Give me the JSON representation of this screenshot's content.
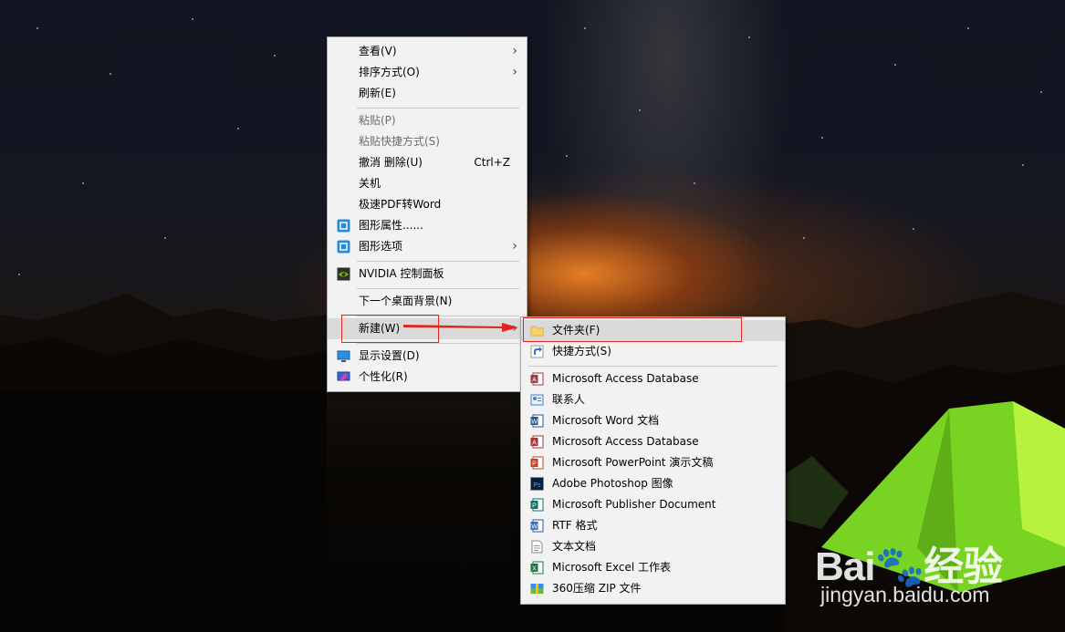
{
  "main_menu": {
    "items": [
      {
        "label": "查看(V)",
        "has_submenu": true
      },
      {
        "label": "排序方式(O)",
        "has_submenu": true
      },
      {
        "label": "刷新(E)"
      },
      {
        "label": "粘贴(P)",
        "disabled": true
      },
      {
        "label": "粘贴快捷方式(S)",
        "disabled": true
      },
      {
        "label": "撤消 删除(U)",
        "shortcut": "Ctrl+Z"
      },
      {
        "label": "关机"
      },
      {
        "label": "极速PDF转Word"
      },
      {
        "label": "图形属性......",
        "icon": "intel-graphics-icon"
      },
      {
        "label": "图形选项",
        "icon": "intel-graphics-icon",
        "has_submenu": true
      },
      {
        "label": "NVIDIA 控制面板",
        "icon": "nvidia-icon"
      },
      {
        "label": "下一个桌面背景(N)"
      },
      {
        "label": "新建(W)",
        "has_submenu": true,
        "highlighted": true
      },
      {
        "label": "显示设置(D)",
        "icon": "display-settings-icon"
      },
      {
        "label": "个性化(R)",
        "icon": "personalize-icon"
      }
    ]
  },
  "new_submenu": {
    "items": [
      {
        "label": "文件夹(F)",
        "icon": "folder-icon",
        "highlighted": true
      },
      {
        "label": "快捷方式(S)",
        "icon": "shortcut-icon"
      },
      {
        "label": "Microsoft Access Database",
        "icon": "access-icon"
      },
      {
        "label": "联系人",
        "icon": "contact-icon"
      },
      {
        "label": "Microsoft Word 文档",
        "icon": "word-icon"
      },
      {
        "label": "Microsoft Access Database",
        "icon": "access-icon"
      },
      {
        "label": "Microsoft PowerPoint 演示文稿",
        "icon": "powerpoint-icon"
      },
      {
        "label": "Adobe Photoshop 图像",
        "icon": "photoshop-icon"
      },
      {
        "label": "Microsoft Publisher Document",
        "icon": "publisher-icon"
      },
      {
        "label": "RTF 格式",
        "icon": "rtf-icon"
      },
      {
        "label": "文本文档",
        "icon": "text-document-icon"
      },
      {
        "label": "Microsoft Excel 工作表",
        "icon": "excel-icon"
      },
      {
        "label": "360压缩 ZIP 文件",
        "icon": "zip-archive-icon"
      }
    ]
  },
  "watermark": {
    "logo": "Bai🐾经验",
    "url": "jingyan.baidu.com"
  },
  "colors": {
    "menu_bg": "#f2f2f2",
    "highlight": "#dadada",
    "annotation_red": "#e02424"
  }
}
